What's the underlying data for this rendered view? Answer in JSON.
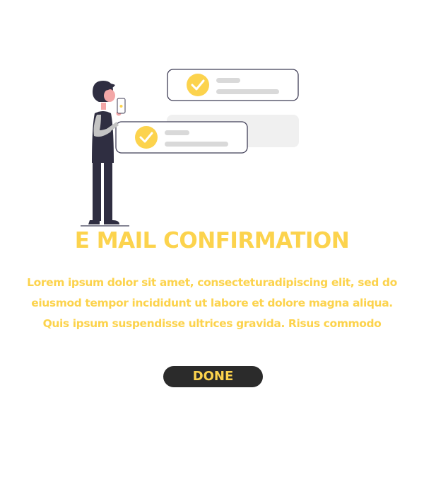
{
  "title": "E MAIL CONFIRMATION",
  "body": {
    "line1": "Lorem ipsum dolor sit amet, consecteturadipiscing elit, sed do",
    "line2": "eiusmod tempor incididunt ut labore et dolore magna aliqua.",
    "line3": "Quis ipsum suspendisse ultrices gravida. Risus commodo"
  },
  "done_button": "DONE",
  "illustration": {
    "icons": [
      "check-icon",
      "check-icon"
    ]
  },
  "colors": {
    "accent": "#fcd34d",
    "button_bg": "#2b2b2b",
    "card_border": "#3f3d56",
    "placeholder": "#d9d9d9",
    "ghost_card": "#f0f0f0"
  }
}
